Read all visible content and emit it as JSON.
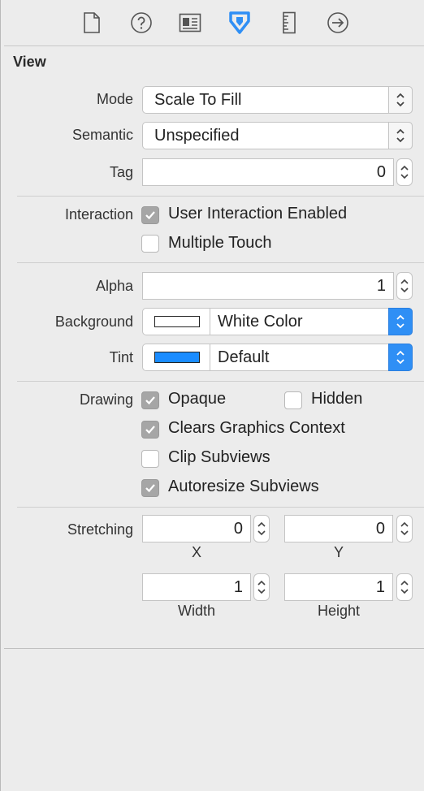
{
  "toolbar": {
    "icons": [
      "file-icon",
      "help-icon",
      "identity-icon",
      "attributes-icon",
      "size-icon",
      "connections-icon"
    ],
    "accent": "#2f8ff5"
  },
  "view": {
    "title": "View",
    "mode": {
      "label": "Mode",
      "value": "Scale To Fill"
    },
    "semantic": {
      "label": "Semantic",
      "value": "Unspecified"
    },
    "tag": {
      "label": "Tag",
      "value": "0"
    },
    "interaction": {
      "label": "Interaction",
      "user_interaction": {
        "label": "User Interaction Enabled",
        "checked": true
      },
      "multiple_touch": {
        "label": "Multiple Touch",
        "checked": false
      }
    },
    "alpha": {
      "label": "Alpha",
      "value": "1"
    },
    "background": {
      "label": "Background",
      "value": "White Color",
      "swatch": "#ffffff"
    },
    "tint": {
      "label": "Tint",
      "value": "Default",
      "swatch": "#1a8cff"
    },
    "drawing": {
      "label": "Drawing",
      "opaque": {
        "label": "Opaque",
        "checked": true
      },
      "hidden": {
        "label": "Hidden",
        "checked": false
      },
      "clears": {
        "label": "Clears Graphics Context",
        "checked": true
      },
      "clip": {
        "label": "Clip Subviews",
        "checked": false
      },
      "autoresize": {
        "label": "Autoresize Subviews",
        "checked": true
      }
    },
    "stretching": {
      "label": "Stretching",
      "x": {
        "label": "X",
        "value": "0"
      },
      "y": {
        "label": "Y",
        "value": "0"
      },
      "width": {
        "label": "Width",
        "value": "1"
      },
      "height": {
        "label": "Height",
        "value": "1"
      }
    }
  }
}
